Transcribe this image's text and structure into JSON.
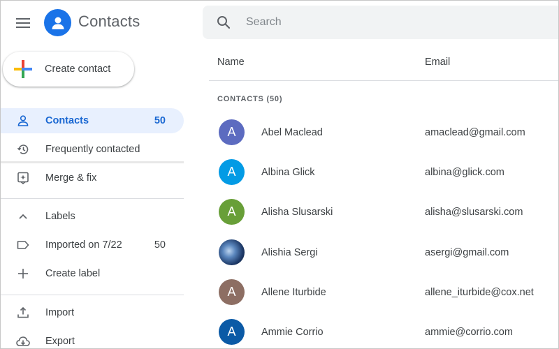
{
  "header": {
    "app_title": "Contacts",
    "search_placeholder": "Search",
    "brand_color": "#1a73e8"
  },
  "sidebar": {
    "create_label": "Create contact",
    "nav": [
      {
        "label": "Contacts",
        "count": "50",
        "icon": "person-icon",
        "active": true
      },
      {
        "label": "Frequently contacted",
        "count": "",
        "icon": "history-icon"
      },
      {
        "label": "Merge & fix",
        "count": "",
        "icon": "merge-fix-icon"
      }
    ],
    "labels_section": {
      "header": "Labels",
      "items": [
        {
          "label": "Imported on 7/22",
          "count": "50",
          "icon": "label-icon"
        },
        {
          "label": "Create label",
          "count": "",
          "icon": "plus-icon"
        }
      ]
    },
    "bottom": [
      {
        "label": "Import",
        "icon": "upload-icon"
      },
      {
        "label": "Export",
        "icon": "cloud-download-icon"
      }
    ]
  },
  "main": {
    "columns": {
      "name": "Name",
      "email": "Email"
    },
    "section_label": "CONTACTS (50)",
    "contacts": [
      {
        "initial": "A",
        "name": "Abel Maclead",
        "email": "amaclead@gmail.com",
        "color": "#5c6bc0"
      },
      {
        "initial": "A",
        "name": "Albina Glick",
        "email": "albina@glick.com",
        "color": "#039be5"
      },
      {
        "initial": "A",
        "name": "Alisha Slusarski",
        "email": "alisha@slusarski.com",
        "color": "#689f38"
      },
      {
        "initial": "",
        "name": "Alishia Sergi",
        "email": "asergi@gmail.com",
        "color": "photo"
      },
      {
        "initial": "A",
        "name": "Allene Iturbide",
        "email": "allene_iturbide@cox.net",
        "color": "#8d6e63"
      },
      {
        "initial": "A",
        "name": "Ammie Corrio",
        "email": "ammie@corrio.com",
        "color": "#0b5aa6"
      }
    ]
  }
}
